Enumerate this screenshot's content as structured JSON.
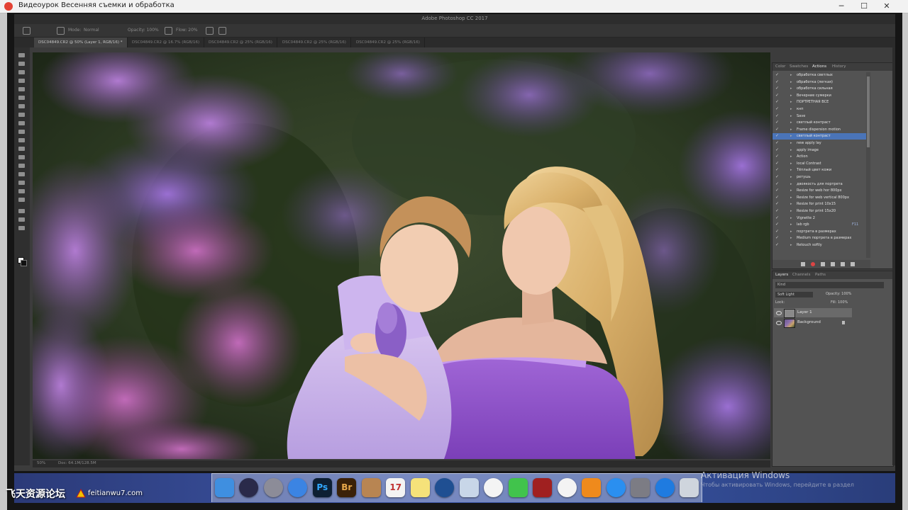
{
  "window": {
    "title": "Видеоурок Весенняя съемки и обработка",
    "minimize": "─",
    "maximize": "☐",
    "close": "✕"
  },
  "photoshop": {
    "title": "Adobe Photoshop CC 2017",
    "options": {
      "mode": "Mode:",
      "mode_value": "Normal",
      "opacity": "Opacity: 100%",
      "flow": "Flow: 20%"
    },
    "tabs": [
      "DSC04849.CR2 @ 50% (Layer 1, RGB/16) *",
      "DSC04849.CR2 @ 16.7% (RGB/16)",
      "DSC04849.CR2 @ 25% (RGB/16)",
      "DSC04849.CR2 @ 25% (RGB/16)",
      "DSC04849.CR2 @ 25% (RGB/16)"
    ],
    "status": {
      "zoom": "50%",
      "doc": "Doc: 64.1M/128.5M"
    }
  },
  "actions_panel": {
    "tabs": [
      "Color",
      "Swatches",
      "Actions",
      "History"
    ],
    "active_tab": "Actions",
    "rows": [
      {
        "label": "обработка светлых",
        "value": ""
      },
      {
        "label": "обработка (легкая)",
        "value": ""
      },
      {
        "label": "обработка сильная",
        "value": ""
      },
      {
        "label": "Вечерние сумерки",
        "value": ""
      },
      {
        "label": "ПОРТРЕТНАЯ ВСЕ",
        "value": ""
      },
      {
        "label": "кнп",
        "value": ""
      },
      {
        "label": "Save",
        "value": ""
      },
      {
        "label": "светлый контраст",
        "value": ""
      },
      {
        "label": "Frame dispersion motion",
        "value": ""
      },
      {
        "label": "светлый контраст",
        "value": "",
        "selected": true
      },
      {
        "label": "new apply lay",
        "value": ""
      },
      {
        "label": "apply image",
        "value": ""
      },
      {
        "label": "Action",
        "value": ""
      },
      {
        "label": "local Contrast",
        "value": ""
      },
      {
        "label": "Тёплый цвет кожи",
        "value": ""
      },
      {
        "label": "ретушь",
        "value": ""
      },
      {
        "label": "двоякость для портрета",
        "value": ""
      },
      {
        "label": "Resize for web hor 800px",
        "value": ""
      },
      {
        "label": "Resize for web vertical 800px",
        "value": ""
      },
      {
        "label": "Resize for print 10x15",
        "value": ""
      },
      {
        "label": "Resize for print 15x20",
        "value": ""
      },
      {
        "label": "Vignette 2",
        "value": ""
      },
      {
        "label": "lab rgb",
        "value": "F11"
      },
      {
        "label": "портрета в размерах",
        "value": ""
      },
      {
        "label": "Medium портрета в размерах",
        "value": ""
      },
      {
        "label": "Retouch softly",
        "value": ""
      }
    ]
  },
  "layers_panel": {
    "tabs": [
      "Layers",
      "Channels",
      "Paths"
    ],
    "active_tab": "Layers",
    "kind": "Kind",
    "blend_mode": "Soft Light",
    "opacity": "Opacity: 100%",
    "lock": "Lock:",
    "fill": "Fill: 100%",
    "layers": [
      {
        "name": "Layer 1",
        "selected": true
      },
      {
        "name": "Background",
        "selected": false
      }
    ]
  },
  "dock": {
    "apps": [
      {
        "name": "finder-icon",
        "label": "",
        "color": "#3f8fe0"
      },
      {
        "name": "siri-icon",
        "label": "",
        "color": "#2a2a4a"
      },
      {
        "name": "launchpad-icon",
        "label": "",
        "color": "#8c8c98"
      },
      {
        "name": "safari-icon",
        "label": "",
        "color": "#3b84e3"
      },
      {
        "name": "photoshop-icon",
        "label": "Ps",
        "color": "#0d1f33"
      },
      {
        "name": "bridge-icon",
        "label": "Br",
        "color": "#3a2108"
      },
      {
        "name": "contacts-icon",
        "label": "",
        "color": "#b88552"
      },
      {
        "name": "calendar-icon",
        "label": "17",
        "color": "#f3f3f3"
      },
      {
        "name": "notes-icon",
        "label": "",
        "color": "#f5e27a"
      },
      {
        "name": "quicktime-icon",
        "label": "",
        "color": "#1f4f92"
      },
      {
        "name": "preview-icon",
        "label": "",
        "color": "#c8d6e8"
      },
      {
        "name": "photos-icon",
        "label": "",
        "color": "#f4f4f4"
      },
      {
        "name": "messages-icon",
        "label": "",
        "color": "#41c34c"
      },
      {
        "name": "photo-booth-icon",
        "label": "",
        "color": "#a02020"
      },
      {
        "name": "itunes-icon",
        "label": "",
        "color": "#f3f3f3"
      },
      {
        "name": "ibooks-icon",
        "label": "",
        "color": "#ef8a1c"
      },
      {
        "name": "app-store-icon",
        "label": "",
        "color": "#2a8ff0"
      },
      {
        "name": "system-preferences-icon",
        "label": "",
        "color": "#7c7c84"
      },
      {
        "name": "teamviewer-icon",
        "label": "",
        "color": "#1f7be0"
      },
      {
        "name": "trash-icon",
        "label": "",
        "color": "#cfd5dd"
      }
    ]
  },
  "overlay": {
    "activate_windows": "Активация Windows",
    "activate_windows_sub": "Чтобы активировать Windows, перейдите в раздел",
    "watermark": "飞天资源论坛",
    "watermark_url": "feitianwu7.com"
  }
}
